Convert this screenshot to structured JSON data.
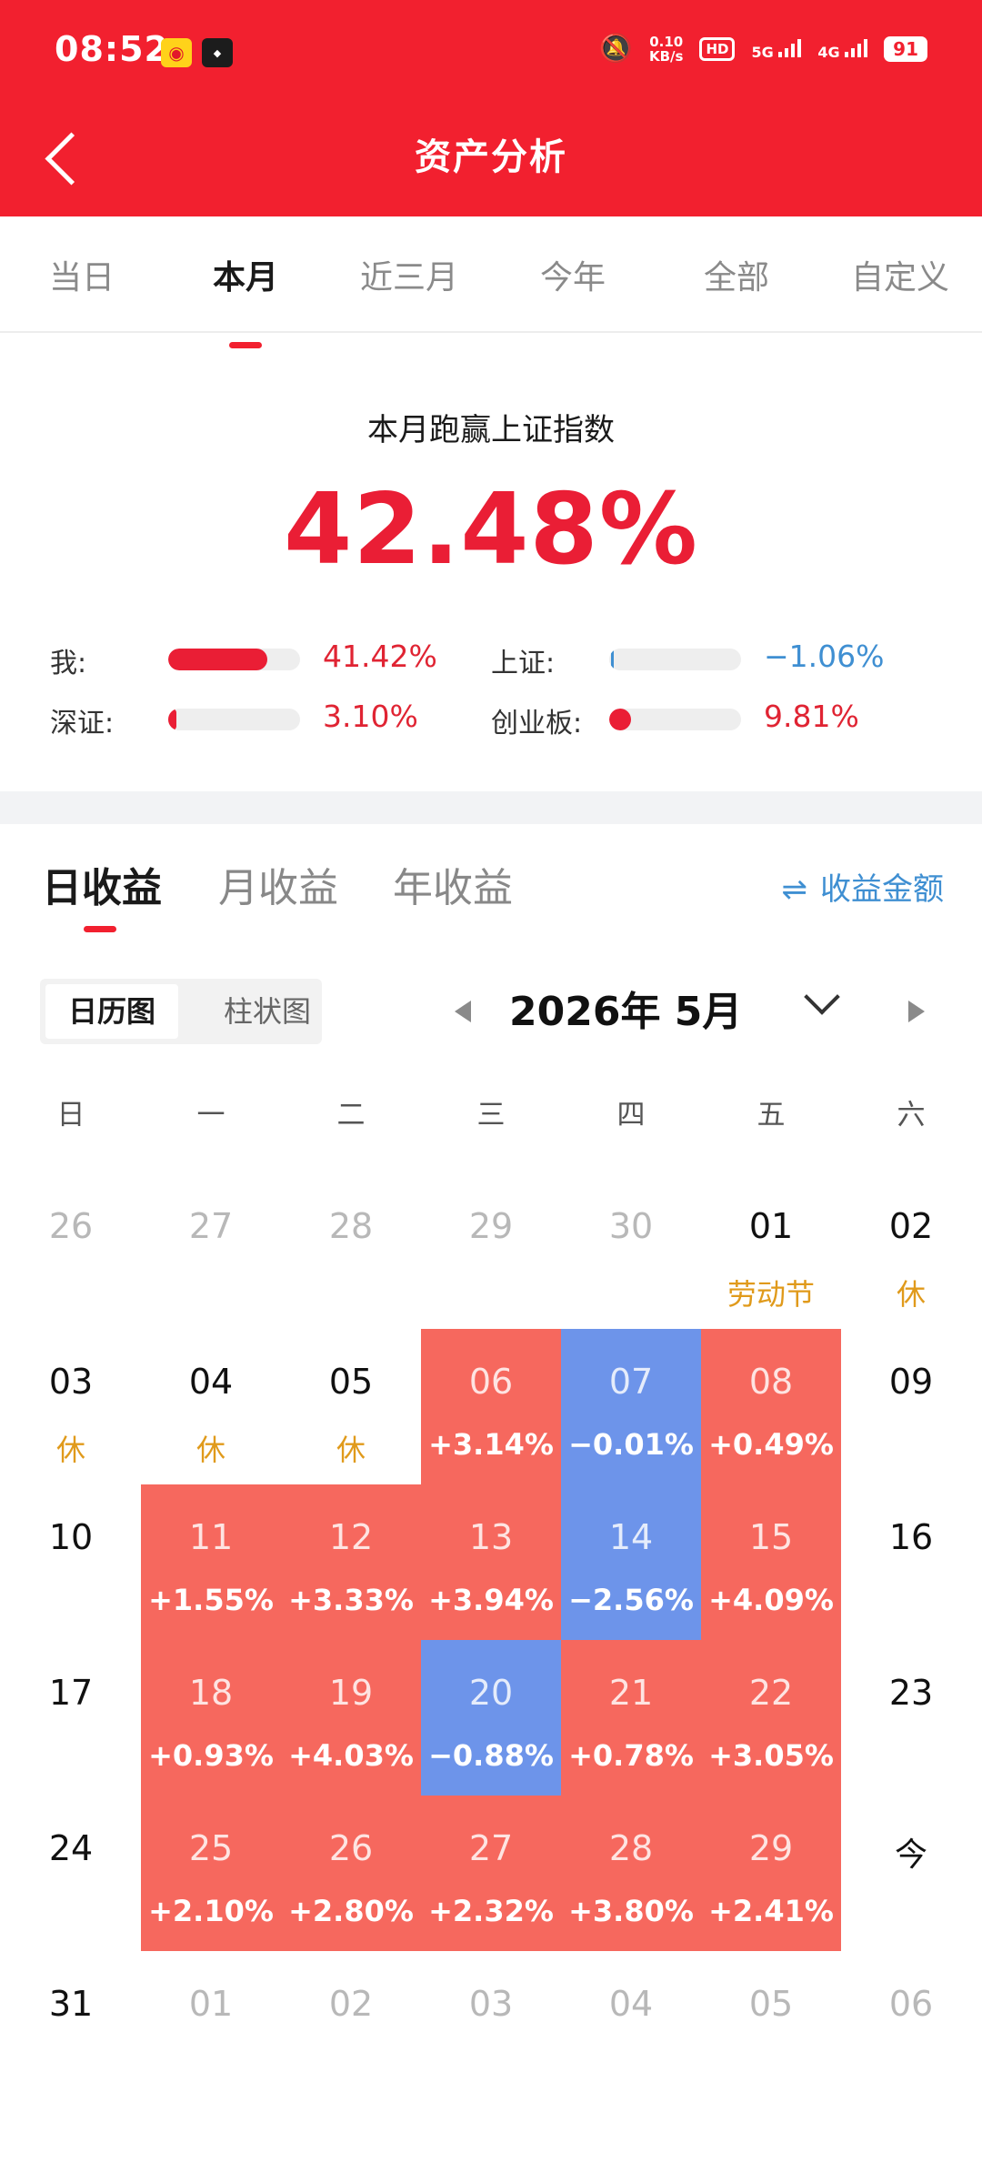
{
  "status_bar": {
    "time": "08:52",
    "speed_top": "0.10",
    "speed_bottom": "KB/s",
    "hd": "HD",
    "net5g": "5G",
    "net4g": "4G",
    "battery": "91"
  },
  "header": {
    "title": "资产分析"
  },
  "period_tabs": [
    {
      "label": "当日",
      "active": false
    },
    {
      "label": "本月",
      "active": true
    },
    {
      "label": "近三月",
      "active": false
    },
    {
      "label": "今年",
      "active": false
    },
    {
      "label": "全部",
      "active": false
    },
    {
      "label": "自定义",
      "active": false
    }
  ],
  "summary": {
    "caption": "本月跑赢上证指数",
    "value": "42.48%",
    "comparisons": [
      {
        "label": "我:",
        "value": "41.42%",
        "fraction": 0.75,
        "sign": "pos"
      },
      {
        "label": "上证:",
        "value": "−1.06%",
        "fraction": 0.02,
        "sign": "neg"
      },
      {
        "label": "深证:",
        "value": "3.10%",
        "fraction": 0.06,
        "sign": "pos"
      },
      {
        "label": "创业板:",
        "value": "9.81%",
        "fraction": 0.19,
        "sign": "pos"
      }
    ]
  },
  "income_tabs": [
    {
      "label": "日收益",
      "active": true
    },
    {
      "label": "月收益",
      "active": false
    },
    {
      "label": "年收益",
      "active": false
    }
  ],
  "amount_toggle": {
    "icon": "swap-icon",
    "label": "收益金额"
  },
  "view_toggle": {
    "calendar": "日历图",
    "bar": "柱状图"
  },
  "month": {
    "label": "2026年 5月"
  },
  "weekdays": [
    "日",
    "一",
    "二",
    "三",
    "四",
    "五",
    "六"
  ],
  "colors": {
    "brand_red": "#f2202f",
    "up": "#f6685e",
    "down": "#6d94ea",
    "holiday": "#e09a1b",
    "accent_blue": "#3f8fd2"
  },
  "calendar": [
    [
      {
        "day": "26",
        "state": "other"
      },
      {
        "day": "27",
        "state": "other"
      },
      {
        "day": "28",
        "state": "other"
      },
      {
        "day": "29",
        "state": "other"
      },
      {
        "day": "30",
        "state": "other"
      },
      {
        "day": "01",
        "state": "normal",
        "sub": "劳动节",
        "subType": "holiday"
      },
      {
        "day": "02",
        "state": "normal",
        "sub": "休",
        "subType": "holiday"
      }
    ],
    [
      {
        "day": "03",
        "state": "normal",
        "sub": "休",
        "subType": "holiday"
      },
      {
        "day": "04",
        "state": "normal",
        "sub": "休",
        "subType": "holiday"
      },
      {
        "day": "05",
        "state": "normal",
        "sub": "休",
        "subType": "holiday"
      },
      {
        "day": "06",
        "state": "up",
        "sub": "+3.14%"
      },
      {
        "day": "07",
        "state": "down",
        "sub": "−0.01%"
      },
      {
        "day": "08",
        "state": "up",
        "sub": "+0.49%"
      },
      {
        "day": "09",
        "state": "normal"
      }
    ],
    [
      {
        "day": "10",
        "state": "normal"
      },
      {
        "day": "11",
        "state": "up",
        "sub": "+1.55%"
      },
      {
        "day": "12",
        "state": "up",
        "sub": "+3.33%"
      },
      {
        "day": "13",
        "state": "up",
        "sub": "+3.94%"
      },
      {
        "day": "14",
        "state": "down",
        "sub": "−2.56%"
      },
      {
        "day": "15",
        "state": "up",
        "sub": "+4.09%"
      },
      {
        "day": "16",
        "state": "normal"
      }
    ],
    [
      {
        "day": "17",
        "state": "normal"
      },
      {
        "day": "18",
        "state": "up",
        "sub": "+0.93%"
      },
      {
        "day": "19",
        "state": "up",
        "sub": "+4.03%"
      },
      {
        "day": "20",
        "state": "down",
        "sub": "−0.88%"
      },
      {
        "day": "21",
        "state": "up",
        "sub": "+0.78%"
      },
      {
        "day": "22",
        "state": "up",
        "sub": "+3.05%"
      },
      {
        "day": "23",
        "state": "normal"
      }
    ],
    [
      {
        "day": "24",
        "state": "normal"
      },
      {
        "day": "25",
        "state": "up",
        "sub": "+2.10%"
      },
      {
        "day": "26",
        "state": "up",
        "sub": "+2.80%"
      },
      {
        "day": "27",
        "state": "up",
        "sub": "+2.32%"
      },
      {
        "day": "28",
        "state": "up",
        "sub": "+3.80%"
      },
      {
        "day": "29",
        "state": "up",
        "sub": "+2.41%"
      },
      {
        "day": "今",
        "state": "today"
      }
    ],
    [
      {
        "day": "31",
        "state": "normal"
      },
      {
        "day": "01",
        "state": "other"
      },
      {
        "day": "02",
        "state": "other"
      },
      {
        "day": "03",
        "state": "other"
      },
      {
        "day": "04",
        "state": "other"
      },
      {
        "day": "05",
        "state": "other"
      },
      {
        "day": "06",
        "state": "other"
      }
    ]
  ]
}
